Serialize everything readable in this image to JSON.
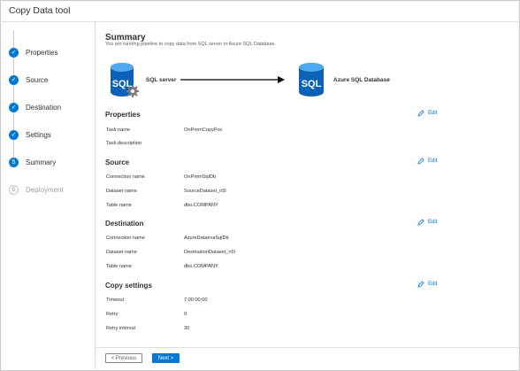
{
  "app": {
    "title": "Copy Data tool"
  },
  "steps": [
    {
      "label": "Properties",
      "status": "done",
      "icon": "check-icon"
    },
    {
      "label": "Source",
      "status": "done",
      "icon": "check-icon"
    },
    {
      "label": "Destination",
      "status": "done",
      "icon": "check-icon"
    },
    {
      "label": "Settings",
      "status": "done",
      "icon": "check-icon"
    },
    {
      "label": "Summary",
      "status": "current",
      "number": "5"
    },
    {
      "label": "Deployment",
      "status": "disabled",
      "number": "6"
    }
  ],
  "summary": {
    "title": "Summary",
    "subtitle": "You are running pipeline to copy data from SQL server to Azure SQL Database.",
    "source_label": "SQL server",
    "dest_label": "Azure SQL Database",
    "db_icon_text": "SQL"
  },
  "edit_label": "Edit",
  "properties": {
    "title": "Properties",
    "rows": [
      {
        "label": "Task name",
        "value": "OnPremCopyPoc"
      },
      {
        "label": "Task description",
        "value": ""
      }
    ]
  },
  "source": {
    "title": "Source",
    "rows": [
      {
        "label": "Connection name",
        "value": "OnPremSqlDb"
      },
      {
        "label": "Dataset name",
        "value": "SourceDataset_n5l"
      },
      {
        "label": "Table name",
        "value": "dbo.COMPANY"
      }
    ]
  },
  "destination": {
    "title": "Destination",
    "rows": [
      {
        "label": "Connection name",
        "value": "AzureDataevaSqlDb"
      },
      {
        "label": "Dataset name",
        "value": "DestinationDataset_n5l"
      },
      {
        "label": "Table name",
        "value": "dbo.COMPANY"
      }
    ]
  },
  "copy_settings": {
    "title": "Copy settings",
    "rows": [
      {
        "label": "Timeout",
        "value": "7.00:00:00"
      },
      {
        "label": "Retry",
        "value": "0"
      },
      {
        "label": "Retry interval",
        "value": "30"
      }
    ]
  },
  "footer": {
    "previous_label": "< Previous",
    "next_label": "Next >"
  },
  "colors": {
    "accent": "#0078d4",
    "db_blue": "#0a62b8"
  }
}
